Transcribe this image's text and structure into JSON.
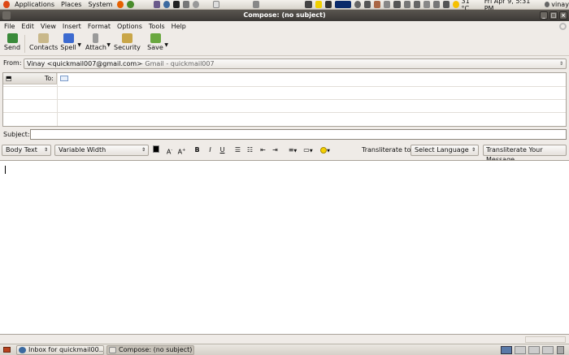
{
  "top_panel": {
    "menus": [
      "Applications",
      "Places",
      "System"
    ],
    "temperature": "31 °C",
    "datetime": "Fri Apr 9, 5:31 PM",
    "user": "vinay"
  },
  "window": {
    "title": "Compose: (no subject)"
  },
  "menubar": [
    "File",
    "Edit",
    "View",
    "Insert",
    "Format",
    "Options",
    "Tools",
    "Help"
  ],
  "toolbar": {
    "send": "Send",
    "contacts": "Contacts",
    "spell": "Spell",
    "attach": "Attach",
    "security": "Security",
    "save": "Save"
  },
  "from": {
    "label": "From:",
    "address": "Vinay <quickmail007@gmail.com>",
    "account": "- Gmail - quickmail007"
  },
  "recipients": {
    "type_label": "To:"
  },
  "subject": {
    "label": "Subject:",
    "value": ""
  },
  "format_bar": {
    "paragraph_style": "Body Text",
    "font": "Variable Width",
    "bold": "B",
    "italic": "I",
    "underline": "U",
    "transliterate_label": "Transliterate to:",
    "language": "Select Language",
    "transliterate_button": "Transliterate Your Message"
  },
  "taskbar": {
    "items": [
      "Inbox for quickmail00...",
      "Compose: (no subject)"
    ]
  },
  "colors": {
    "panel": "#d9d5cd",
    "titlebar": "#3b3835",
    "window_bg": "#efebe7"
  }
}
